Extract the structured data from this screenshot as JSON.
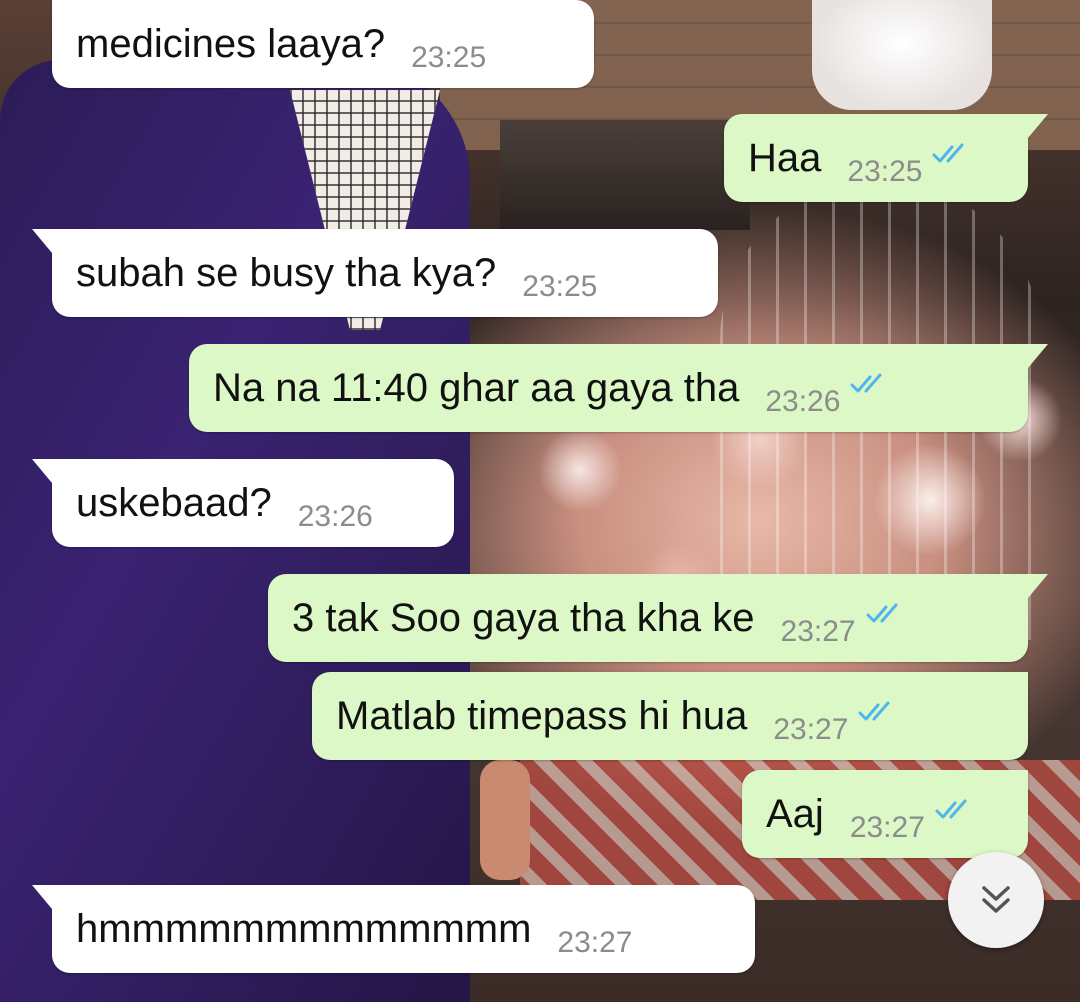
{
  "colors": {
    "incoming_bubble": "#ffffff",
    "outgoing_bubble": "#dcf8c6",
    "timestamp": "#8c8c8c",
    "read_ticks": "#4fb6ec"
  },
  "messages": [
    {
      "direction": "incoming",
      "text": "medicines laaya?",
      "time": "23:25"
    },
    {
      "direction": "outgoing",
      "text": "Haa",
      "time": "23:25",
      "status": "read"
    },
    {
      "direction": "incoming",
      "text": "subah se busy tha kya?",
      "time": "23:25"
    },
    {
      "direction": "outgoing",
      "text": "Na na 11:40 ghar aa gaya tha",
      "time": "23:26",
      "status": "read"
    },
    {
      "direction": "incoming",
      "text": "uskebaad?",
      "time": "23:26"
    },
    {
      "direction": "outgoing",
      "text": "3 tak Soo gaya tha kha ke",
      "time": "23:27",
      "status": "read"
    },
    {
      "direction": "outgoing",
      "text": "Matlab timepass hi hua",
      "time": "23:27",
      "status": "read"
    },
    {
      "direction": "outgoing",
      "text": "Aaj",
      "time": "23:27",
      "status": "read"
    },
    {
      "direction": "incoming",
      "text": "hmmmmmmmmmmmmm",
      "time": "23:27"
    }
  ],
  "scroll_button": {
    "icon": "double-chevron-down-icon"
  }
}
